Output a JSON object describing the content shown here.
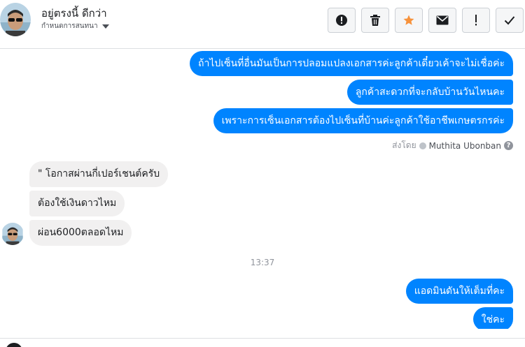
{
  "header": {
    "contact_name": "อยู่ตรงนี้ ดีกว่า",
    "subtitle": "กำหนดการสนทนา",
    "actions": [
      {
        "name": "spam-button",
        "icon": "alert-circle-icon"
      },
      {
        "name": "delete-button",
        "icon": "trash-icon"
      },
      {
        "name": "star-button",
        "icon": "star-icon"
      },
      {
        "name": "mark-unread-button",
        "icon": "envelope-icon"
      },
      {
        "name": "follow-up-button",
        "icon": "exclamation-icon"
      },
      {
        "name": "done-button",
        "icon": "check-icon"
      }
    ]
  },
  "colors": {
    "outgoing_bubble": "#0084ff",
    "incoming_bubble": "#f1f0f0",
    "star": "#f7923b"
  },
  "messages": {
    "outgoing_1": "ถ้าไปเซ็นที่อื่นมันเป็นการปลอมแปลงเอกสารค่ะลูกค้าเดี๋ยวเค้าจะไม่เชื่อค่ะ",
    "outgoing_2": "ลูกค้าสะดวกที่จะกลับบ้านวันไหนคะ",
    "outgoing_3": "เพราะการเซ็นเอกสารต้องไปเซ็นที่บ้านค่ะลูกค้าใช้อาชีพเกษตรกรค่ะ",
    "incoming_1": "\"   โอกาสผ่านกี่เปอร์เชนต์ครับ",
    "incoming_2": "ต้องใช้เงินดาวไหม",
    "incoming_3": "ผ่อน6000ตลอดไหม",
    "outgoing_4": "แอดมินดันให้เต็มที่คะ",
    "outgoing_5": "ใช่คะ"
  },
  "seen": {
    "prefix": "ส่งโดย",
    "name": "Muthita Ubonban",
    "help": "?"
  },
  "timestamp": "13:37"
}
